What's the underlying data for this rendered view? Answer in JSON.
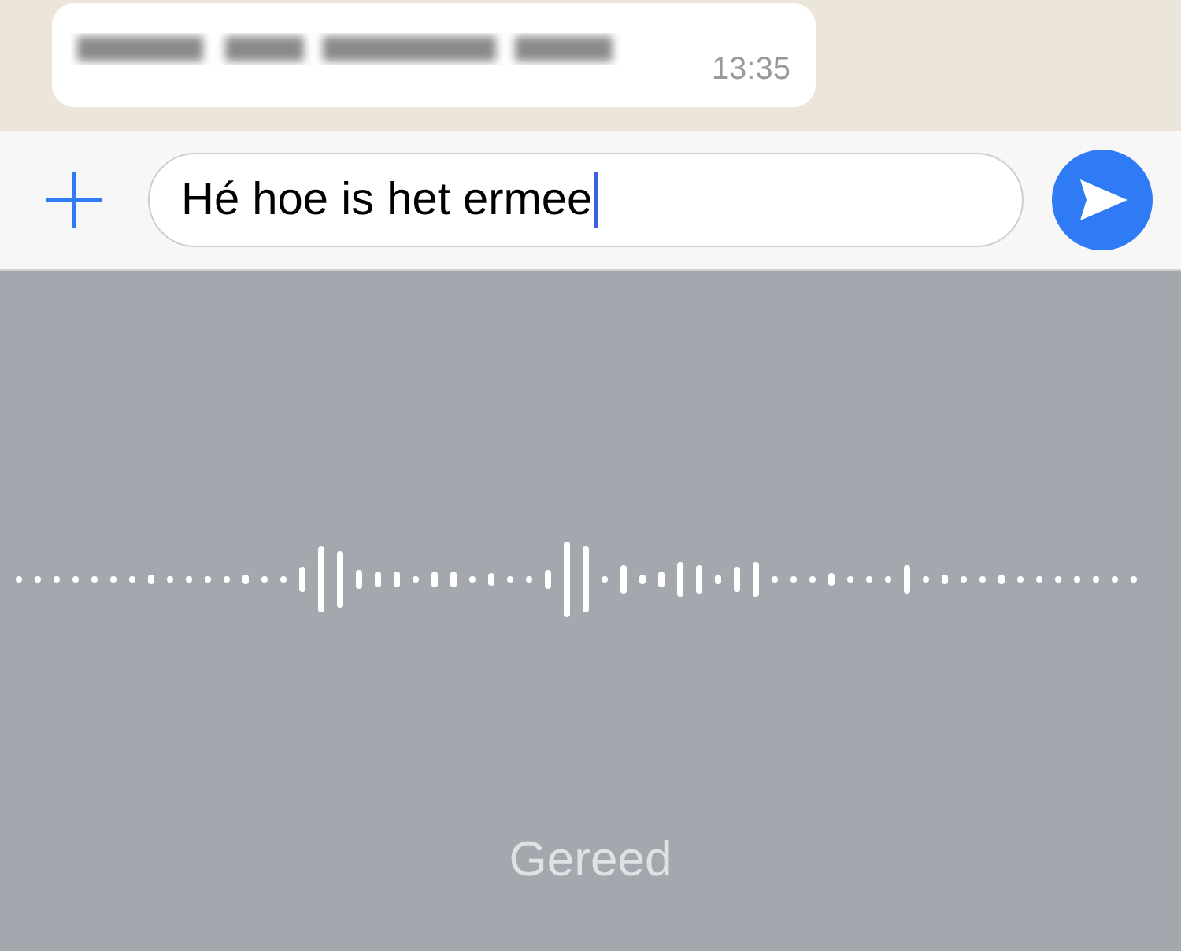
{
  "message": {
    "time": "13:35"
  },
  "composer": {
    "value": "Hé hoe is het ermee"
  },
  "dictation": {
    "done_label": "Gereed"
  }
}
